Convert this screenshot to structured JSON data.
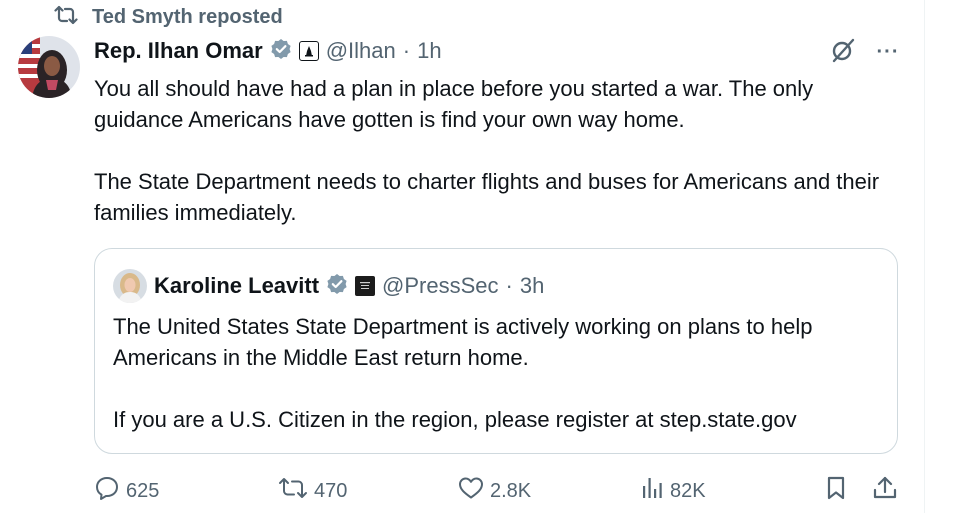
{
  "repost": {
    "label": "Ted Smyth reposted"
  },
  "post": {
    "author_name": "Rep. Ilhan Omar",
    "handle": "@Ilhan",
    "separator": "·",
    "time": "1h",
    "paragraphs": [
      "You all should have had a plan in place before you started a war. The only guidance Americans have gotten is find your own way home.",
      "The State Department needs to charter flights and buses for Americans and their families immediately."
    ]
  },
  "quote": {
    "author_name": "Karoline Leavitt",
    "handle": "@PressSec",
    "separator": "·",
    "time": "3h",
    "paragraphs": [
      "The United States State Department is actively working on plans to help Americans in the Middle East return home.",
      "If you are a U.S. Citizen in the region, please register at step.state.gov"
    ]
  },
  "actions": {
    "replies": "625",
    "reposts": "470",
    "likes": "2.8K",
    "views": "82K"
  },
  "icons": {
    "repost": "repost-icon",
    "verified": "verified-badge-icon",
    "grok": "grok-icon",
    "more": "more-icon",
    "reply": "reply-icon",
    "like": "heart-icon",
    "views": "views-icon",
    "bookmark": "bookmark-icon",
    "share": "share-icon"
  },
  "colors": {
    "text": "#0f1419",
    "secondary": "#536471",
    "border": "#cfd9de",
    "verified": "#829aab"
  }
}
